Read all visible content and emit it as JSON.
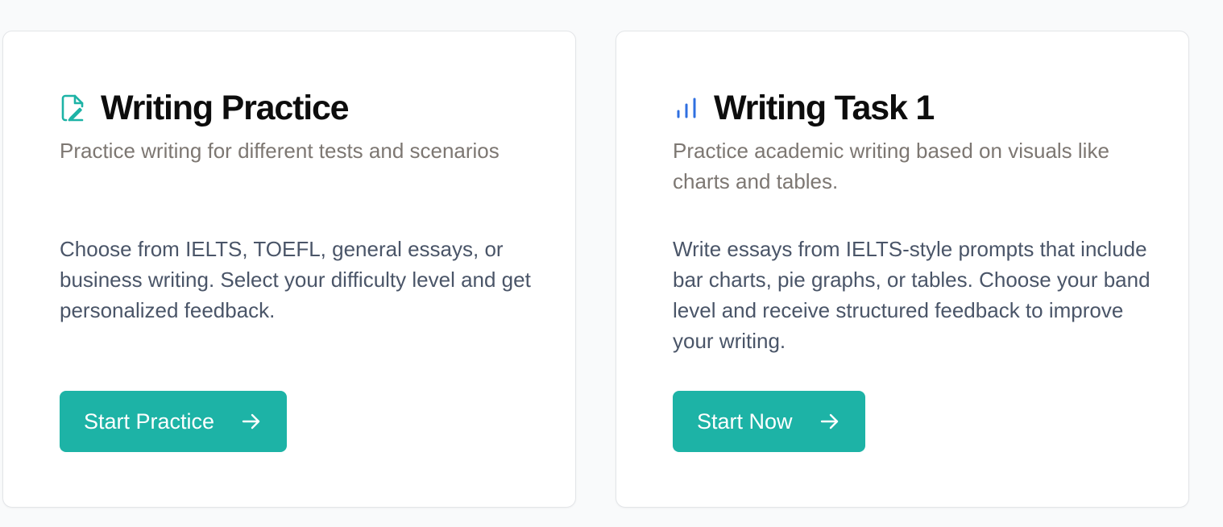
{
  "cards": [
    {
      "title": "Writing Practice",
      "icon": "pen-document-icon",
      "icon_color": "#1db3a6",
      "subtitle": "Practice writing for different tests and scenarios",
      "description": "Choose from IELTS, TOEFL, general essays, or business writing. Select your difficulty level and get personalized feedback.",
      "button_label": "Start Practice",
      "button_icon": "arrow-right-icon"
    },
    {
      "title": "Writing Task 1",
      "icon": "bar-chart-icon",
      "icon_color": "#2f6fe0",
      "subtitle": "Practice academic writing based on visuals like charts and tables.",
      "description": "Write essays from IELTS-style prompts that include bar charts, pie graphs, or tables. Choose your band level and receive structured feedback to improve your writing.",
      "button_label": "Start Now",
      "button_icon": "arrow-right-icon"
    }
  ],
  "colors": {
    "accent": "#1db3a6",
    "title": "#0d0d0d",
    "subtitle": "#7d7772",
    "body": "#4a5568",
    "chart_icon": "#2f6fe0"
  }
}
